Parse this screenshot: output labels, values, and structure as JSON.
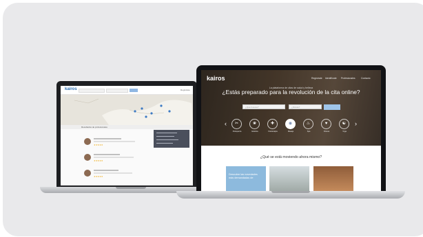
{
  "left_laptop": {
    "logo": "kairos",
    "search_placeholder": "",
    "location_placeholder": "",
    "top_link": "Regístrate",
    "results_title": "Resultados de profesionales",
    "dropdown_items": [
      "",
      "",
      "",
      "",
      ""
    ],
    "results": [
      {
        "name": "",
        "stars": "★★★★★"
      },
      {
        "name": "",
        "stars": "★★★★★"
      },
      {
        "name": "",
        "stars": "★★★★★"
      }
    ]
  },
  "right_laptop": {
    "logo": "kairos",
    "nav": [
      "Regístrate",
      "Identifícate",
      "Profesionales",
      "Contacto"
    ],
    "tagline_small": "La plataforma de citas de salud y belleza",
    "headline": "¿Estás preparado para la revolución de la cita online?",
    "select_service_placeholder": "¿Qué buscas?",
    "select_location_placeholder": "¿Dónde?",
    "categories": [
      "Peluquería",
      "Estética",
      "Fisioterapia",
      "Masaje",
      "Spa",
      "Fitness",
      "Yoga"
    ],
    "section_title": "¿Qué se está moviendo ahora mismo?",
    "tiles": [
      {
        "caption": "Descubre las novedades más demandadas de"
      },
      {
        "caption": ""
      },
      {
        "caption": ""
      }
    ]
  },
  "colors": {
    "background_card": "#e9e9eb",
    "brand_blue": "#2c6fb3",
    "tile_blue": "#8dbadd"
  }
}
